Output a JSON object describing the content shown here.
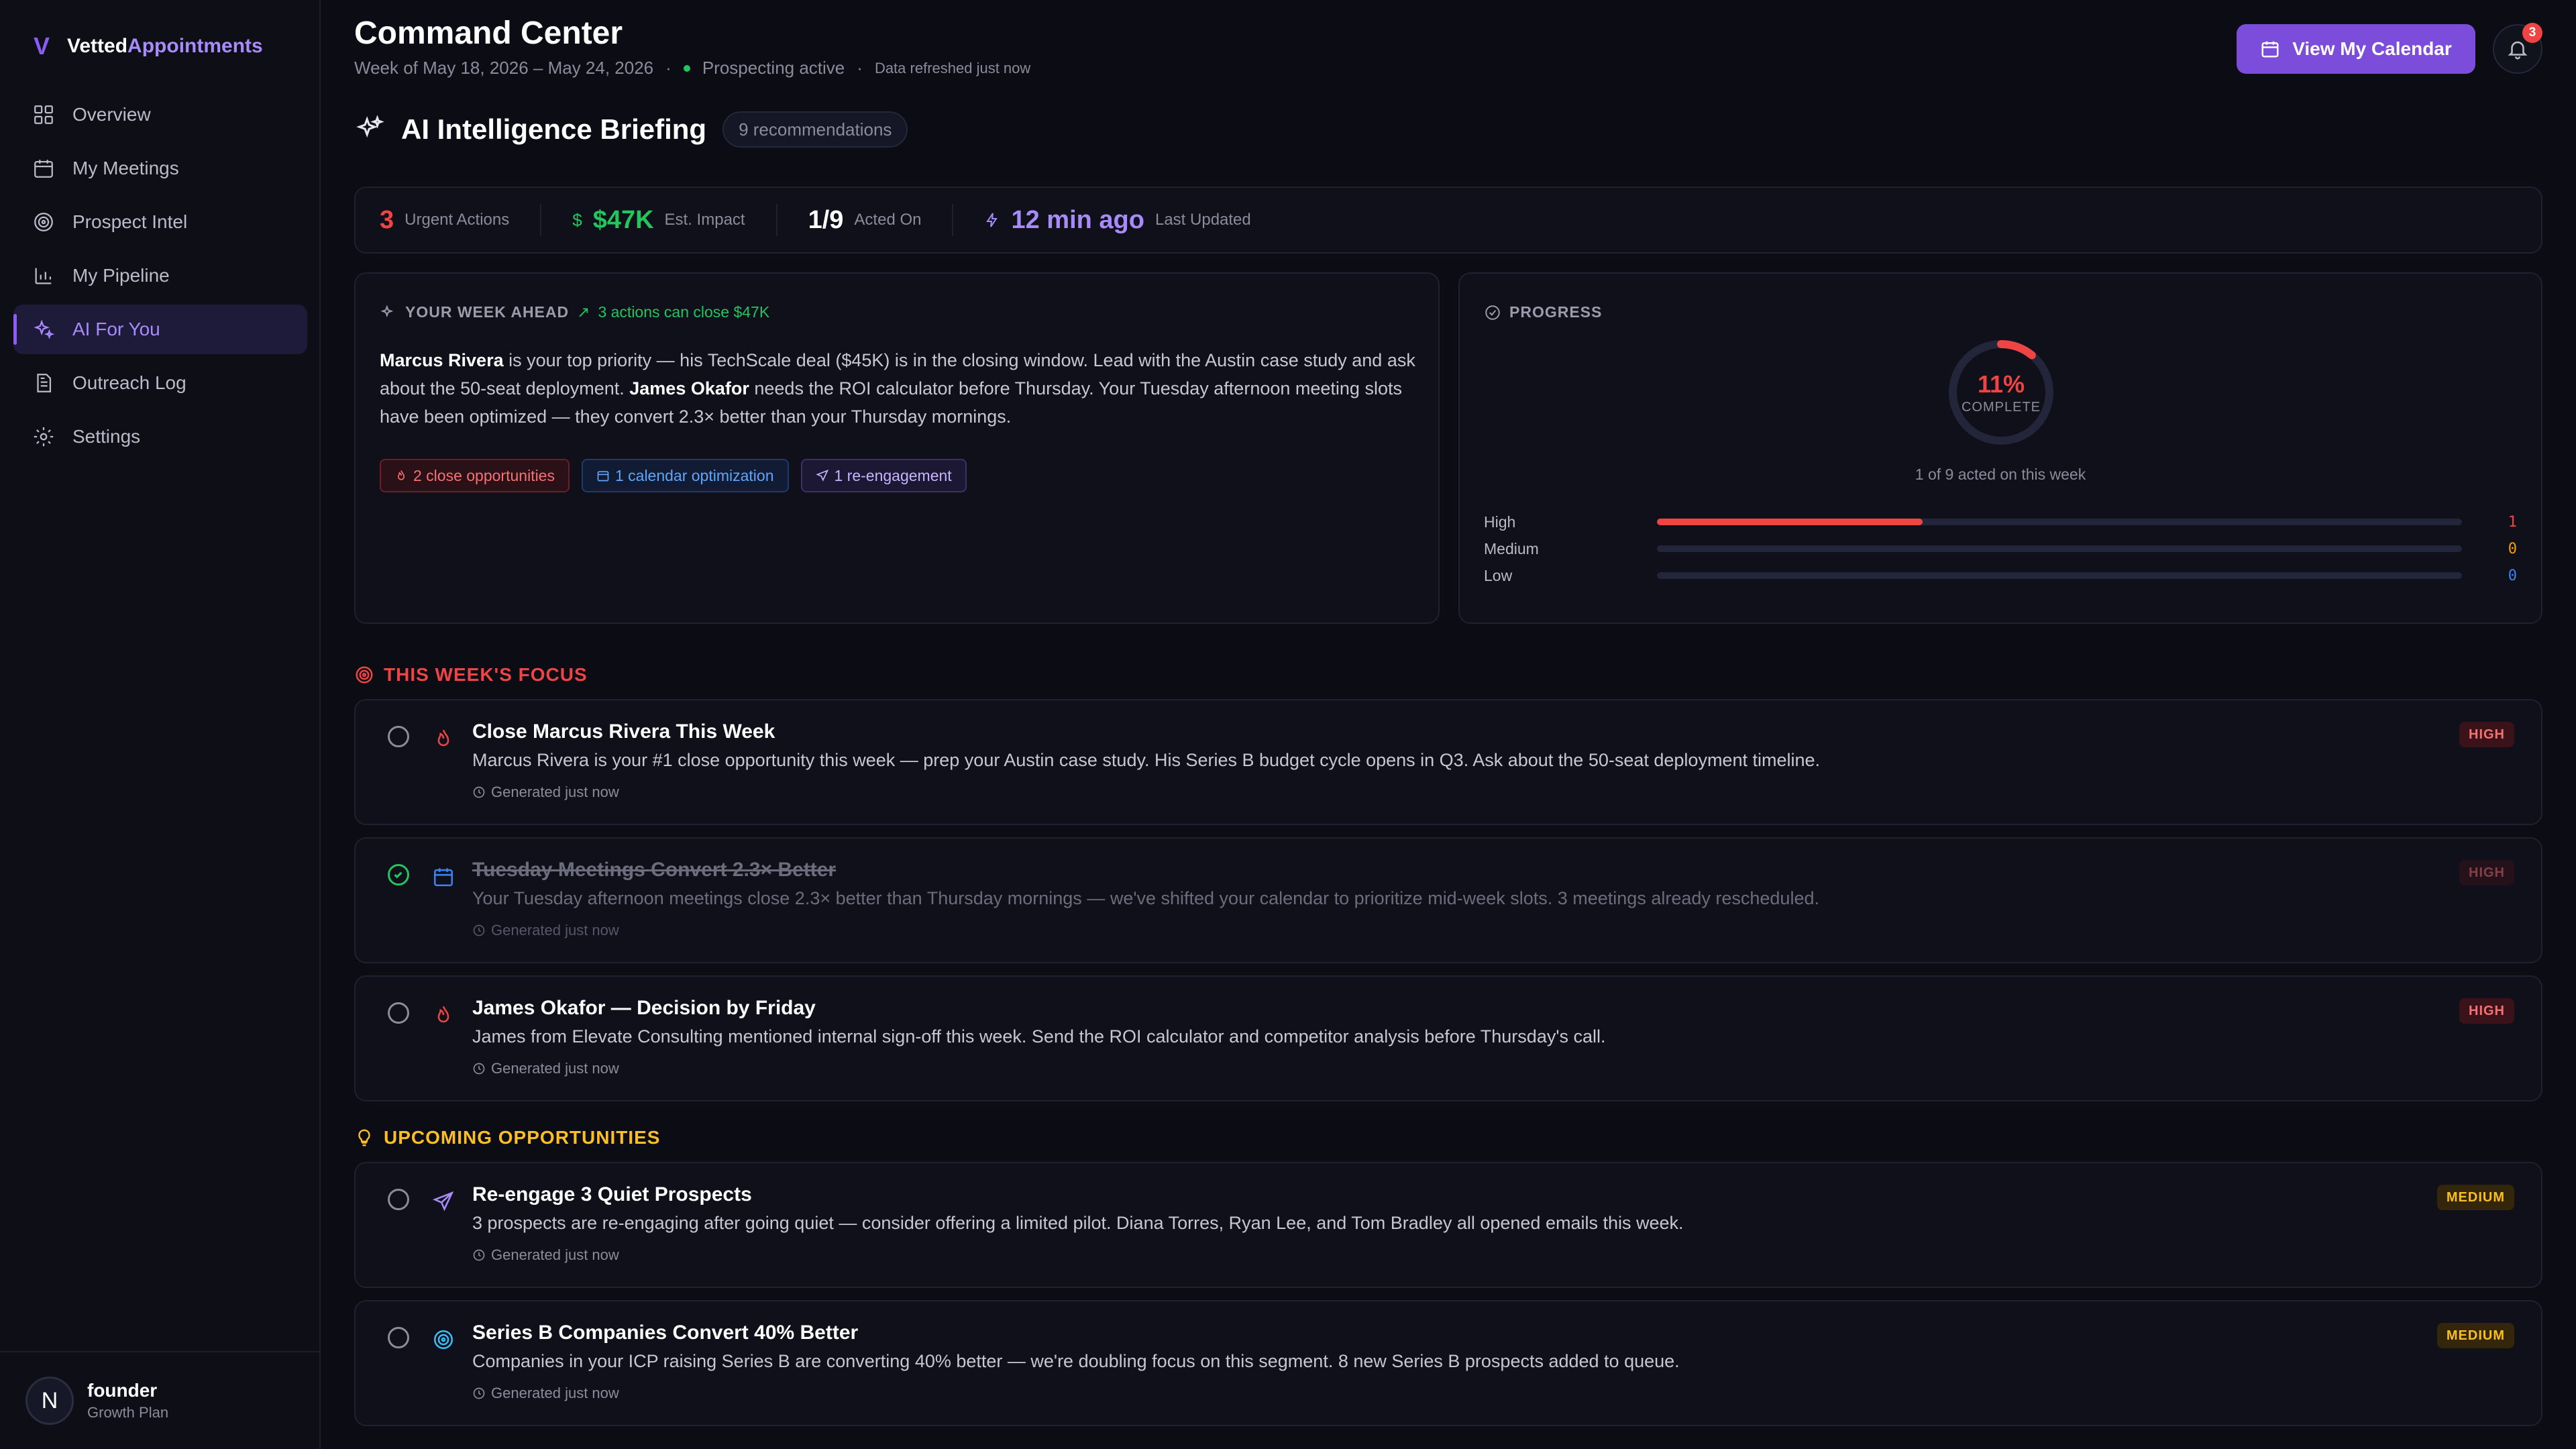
{
  "brand": {
    "mark": "V",
    "name_a": "Vetted",
    "name_b": "Appointments"
  },
  "nav": [
    {
      "label": "Overview"
    },
    {
      "label": "My Meetings"
    },
    {
      "label": "Prospect Intel"
    },
    {
      "label": "My Pipeline"
    },
    {
      "label": "AI For You"
    },
    {
      "label": "Outreach Log"
    },
    {
      "label": "Settings"
    }
  ],
  "user": {
    "initial": "N",
    "name": "founder",
    "plan": "Growth Plan"
  },
  "header": {
    "title": "Command Center",
    "week": "Week of May 18, 2026 – May 24, 2026",
    "status": "Prospecting active",
    "refresh": "Data refreshed just now",
    "calendar_button": "View My Calendar",
    "notifications": "3"
  },
  "briefing": {
    "title": "AI Intelligence Briefing",
    "count": "9 recommendations"
  },
  "stats": [
    {
      "value": "3",
      "label": "Urgent Actions"
    },
    {
      "prefix": "$",
      "value": "$47K",
      "label": "Est. Impact"
    },
    {
      "value": "1/9",
      "label": "Acted On"
    },
    {
      "value": "12 min ago",
      "label": "Last Updated"
    }
  ],
  "week_ahead": {
    "heading": "YOUR WEEK AHEAD",
    "note": "3 actions can close $47K",
    "p1_name": "Marcus Rivera",
    "p1_text": " is your top priority — his TechScale deal ($45K) is in the closing window. Lead with the Austin case study and ask about the 50-seat deployment. ",
    "p2_name": "James Okafor",
    "p2_text": " needs the ROI calculator before Thursday. Your Tuesday afternoon meeting slots have been optimized — they convert 2.3× better than your Thursday mornings.",
    "tags": [
      "2 close opportunities",
      "1 calendar optimization",
      "1 re-engagement"
    ]
  },
  "progress": {
    "heading": "PROGRESS",
    "percent": "11%",
    "percent_value": 0.11,
    "complete_label": "COMPLETE",
    "acted": "1 of 9 acted on this week",
    "priorities": [
      {
        "name": "High",
        "count": "1",
        "fraction": 0.33,
        "color": "#ef4444"
      },
      {
        "name": "Medium",
        "count": "0",
        "fraction": 0,
        "color": "#f59e0b"
      },
      {
        "name": "Low",
        "count": "0",
        "fraction": 0,
        "color": "#3b82f6"
      }
    ]
  },
  "focus": {
    "heading": "THIS WEEK'S FOCUS",
    "items": [
      {
        "title": "Close Marcus Rivera This Week",
        "desc": "Marcus Rivera is your #1 close opportunity this week — prep your Austin case study. His Series B budget cycle opens in Q3. Ask about the 50-seat deployment timeline.",
        "generated": "Generated just now",
        "badge": "HIGH",
        "icon": "flame-icon",
        "done": false
      },
      {
        "title": "Tuesday Meetings Convert 2.3× Better",
        "desc": "Your Tuesday afternoon meetings close 2.3× better than Thursday mornings — we've shifted your calendar to prioritize mid-week slots. 3 meetings already rescheduled.",
        "generated": "Generated just now",
        "badge": "HIGH",
        "icon": "calendar-icon",
        "done": true
      },
      {
        "title": "James Okafor — Decision by Friday",
        "desc": "James from Elevate Consulting mentioned internal sign-off this week. Send the ROI calculator and competitor analysis before Thursday's call.",
        "generated": "Generated just now",
        "badge": "HIGH",
        "icon": "flame-icon",
        "done": false
      }
    ]
  },
  "upcoming": {
    "heading": "UPCOMING OPPORTUNITIES",
    "items": [
      {
        "title": "Re-engage 3 Quiet Prospects",
        "desc": "3 prospects are re-engaging after going quiet — consider offering a limited pilot. Diana Torres, Ryan Lee, and Tom Bradley all opened emails this week.",
        "generated": "Generated just now",
        "badge": "MEDIUM",
        "icon": "send-icon",
        "done": false
      },
      {
        "title": "Series B Companies Convert 40% Better",
        "desc": "Companies in your ICP raising Series B are converting 40% better — we're doubling focus on this segment. 8 new Series B prospects added to queue.",
        "generated": "Generated just now",
        "badge": "MEDIUM",
        "icon": "target-icon",
        "done": false
      }
    ]
  },
  "colors": {
    "accent": "#8b5cf6",
    "urgent": "#ef4444",
    "impact": "#22c55e",
    "medium": "#fbbf24"
  }
}
